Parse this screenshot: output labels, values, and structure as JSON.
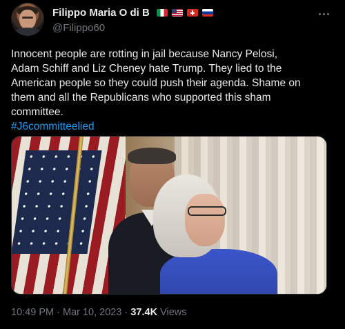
{
  "author": {
    "display_name": "Filippo Maria O di B",
    "handle": "@Filippo60",
    "flags": [
      "italy-flag-icon",
      "us-flag-icon",
      "switzerland-flag-icon",
      "russia-flag-icon"
    ]
  },
  "tweet": {
    "text_lines": [
      "Innocent people are rotting in jail because Nancy Pelosi,",
      "Adam Schiff and Liz Cheney hate Trump. They lied to the",
      "American people so they could push their agenda.  Shame on",
      "them and all the Republicans who supported this sham",
      "committee."
    ],
    "hashtag": "#J6committeelied",
    "photo_label": ""
  },
  "meta": {
    "time": "10:49 PM",
    "separator": "·",
    "date": "Mar 10, 2023",
    "views_count": "37.4K",
    "views_label": "Views"
  },
  "colors": {
    "background": "#000000",
    "text": "#e7e9ea",
    "muted": "#71767b",
    "link": "#1d9bf0"
  }
}
